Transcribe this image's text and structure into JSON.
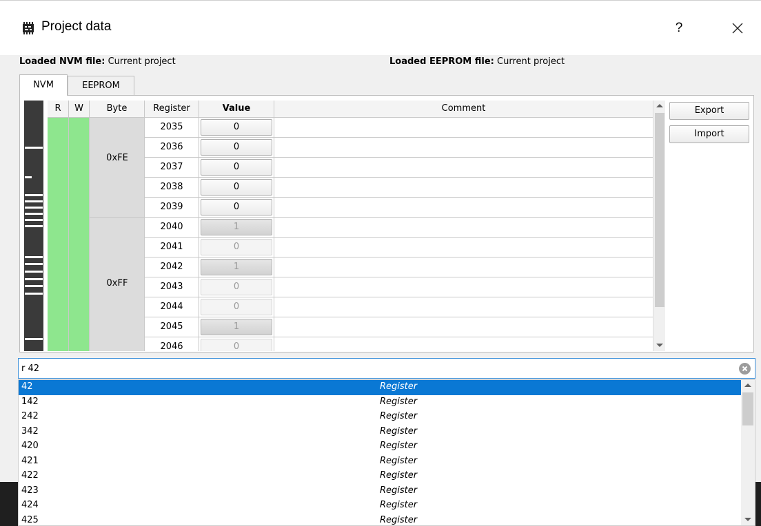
{
  "window": {
    "title": "Project data",
    "help_glyph": "?",
    "app_icon": "chip-icon",
    "close_icon": "close-icon"
  },
  "files": {
    "nvm_label": "Loaded NVM file:",
    "nvm_value": "Current project",
    "eeprom_label": "Loaded EEPROM file:",
    "eeprom_value": "Current project"
  },
  "tabs": [
    {
      "label": "NVM",
      "active": true
    },
    {
      "label": "EEPROM",
      "active": false
    }
  ],
  "table": {
    "headers": {
      "r": "R",
      "w": "W",
      "byte": "Byte",
      "register": "Register",
      "value": "Value",
      "comment": "Comment"
    },
    "byte_groups": [
      {
        "label": "0xFE",
        "first_row": 0,
        "rows": 5
      },
      {
        "label": "0xFF",
        "first_row": 5,
        "rows": 7
      }
    ],
    "rows": [
      {
        "register": "2035",
        "value": "0",
        "state": "normal",
        "comment": ""
      },
      {
        "register": "2036",
        "value": "0",
        "state": "normal",
        "comment": ""
      },
      {
        "register": "2037",
        "value": "0",
        "state": "normal",
        "comment": ""
      },
      {
        "register": "2038",
        "value": "0",
        "state": "normal",
        "comment": ""
      },
      {
        "register": "2039",
        "value": "0",
        "state": "normal",
        "comment": ""
      },
      {
        "register": "2040",
        "value": "1",
        "state": "set",
        "comment": ""
      },
      {
        "register": "2041",
        "value": "0",
        "state": "dim",
        "comment": ""
      },
      {
        "register": "2042",
        "value": "1",
        "state": "set",
        "comment": ""
      },
      {
        "register": "2043",
        "value": "0",
        "state": "dim",
        "comment": ""
      },
      {
        "register": "2044",
        "value": "0",
        "state": "dim",
        "comment": ""
      },
      {
        "register": "2045",
        "value": "1",
        "state": "set",
        "comment": ""
      },
      {
        "register": "2046",
        "value": "0",
        "state": "dim",
        "comment": ""
      }
    ]
  },
  "actions": {
    "export_label": "Export",
    "import_label": "Import"
  },
  "search": {
    "value": "r 42",
    "clear_icon": "clear-icon"
  },
  "results": [
    {
      "number": "42",
      "type": "Register",
      "selected": true
    },
    {
      "number": "142",
      "type": "Register",
      "selected": false
    },
    {
      "number": "242",
      "type": "Register",
      "selected": false
    },
    {
      "number": "342",
      "type": "Register",
      "selected": false
    },
    {
      "number": "420",
      "type": "Register",
      "selected": false
    },
    {
      "number": "421",
      "type": "Register",
      "selected": false
    },
    {
      "number": "422",
      "type": "Register",
      "selected": false
    },
    {
      "number": "423",
      "type": "Register",
      "selected": false
    },
    {
      "number": "424",
      "type": "Register",
      "selected": false
    },
    {
      "number": "425",
      "type": "Register",
      "selected": false
    }
  ],
  "colors": {
    "accent": "#0a78d4",
    "rw_green": "#8ee68e",
    "byte_gray": "#dcdcdc"
  }
}
